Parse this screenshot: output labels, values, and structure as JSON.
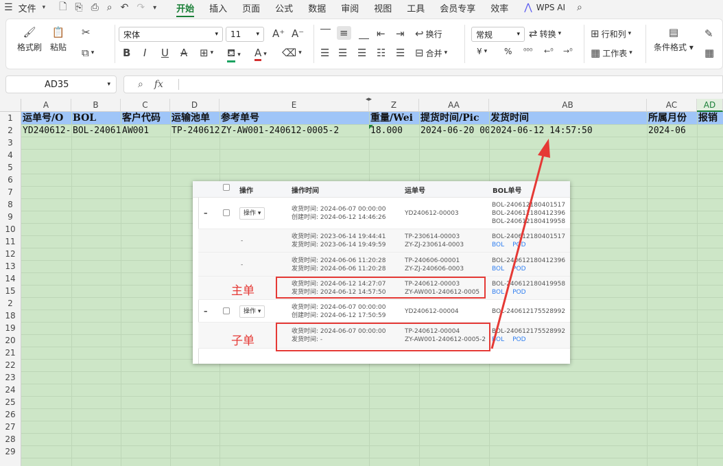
{
  "menubar": {
    "file": "文件",
    "tabs": [
      "开始",
      "插入",
      "页面",
      "公式",
      "数据",
      "审阅",
      "视图",
      "工具",
      "会员专享",
      "效率"
    ],
    "wps_ai": "WPS AI"
  },
  "ribbon": {
    "format_painter": "格式刷",
    "paste": "粘贴",
    "font_name": "宋体",
    "font_size": "11",
    "wrap": "换行",
    "merge": "合并",
    "number_format": "常规",
    "convert": "转换",
    "row_col": "行和列",
    "worksheet": "工作表",
    "cond_format": "条件格式",
    "currency_symbol": "¥",
    "percent": "%"
  },
  "formula_bar": {
    "name_box": "AD35",
    "fx": "fx",
    "value": ""
  },
  "columns": [
    "A",
    "B",
    "C",
    "D",
    "E",
    "Z",
    "AA",
    "AB",
    "AC",
    "AD"
  ],
  "rows": [
    "1",
    "2",
    "3",
    "4",
    "5",
    "6",
    "7",
    "8",
    "9",
    "10",
    "11",
    "12",
    "13",
    "14",
    "15",
    "2",
    "18",
    "19",
    "20",
    "21",
    "22",
    "23",
    "24",
    "25",
    "26",
    "27",
    "28",
    "29"
  ],
  "row1": [
    "运单号/O",
    "BOL",
    "客户代码",
    "运输池单",
    "参考单号",
    "重量/Wei",
    "提货时间/Pic",
    "发货时间",
    "所属月份",
    "报销"
  ],
  "row2": [
    "YD240612-",
    "BOL-24061",
    "AW001",
    "TP-240612",
    "ZY-AW001-240612-0005-2",
    "18.000",
    "2024-06-20 00",
    "2024-06-12 14:57:50",
    "2024-06",
    ""
  ],
  "pasted_image": {
    "headers": {
      "op": "操作",
      "op_time": "操作时间",
      "waybill": "运单号",
      "bol": "BOL单号"
    },
    "op_button": "操作",
    "rows": [
      {
        "expand": "–",
        "op": "btn",
        "t1": "收货时间:  2024-06-07 00:00:00",
        "t2": "创建时间:  2024-06-12 14:46:26",
        "w1": "YD240612-00003",
        "w2": "",
        "b1": "BOL-240612180401517",
        "b2": "BOL-240612180412396",
        "b3": "BOL-240612180419958",
        "links": false
      },
      {
        "expand": "",
        "op": "-",
        "t1": "收货时间:  2023-06-14 19:44:41",
        "t2": "发货时间:  2023-06-14 19:49:59",
        "w1": "TP-230614-00003",
        "w2": "ZY-ZJ-230614-0003",
        "b1": "BOL-240612180401517",
        "b2": "",
        "b3": "",
        "links": true
      },
      {
        "expand": "",
        "op": "-",
        "t1": "收货时间:  2024-06-06 11:20:28",
        "t2": "发货时间:  2024-06-06 11:20:28",
        "w1": "TP-240606-00001",
        "w2": "ZY-ZJ-240606-0003",
        "b1": "BOL-240612180412396",
        "b2": "",
        "b3": "",
        "links": true
      },
      {
        "expand": "",
        "op": "",
        "t1": "收货时间:  2024-06-12 14:27:07",
        "t2": "发货时间:  2024-06-12 14:57:50",
        "w1": "TP-240612-00003",
        "w2": "ZY-AW001-240612-0005",
        "b1": "BOL-240612180419958",
        "b2": "",
        "b3": "",
        "links": true
      },
      {
        "expand": "–",
        "op": "btn",
        "t1": "收货时间:  2024-06-07 00:00:00",
        "t2": "创建时间:  2024-06-12 17:50:59",
        "w1": "YD240612-00004",
        "w2": "",
        "b1": "BOL-240612175528992",
        "b2": "",
        "b3": "",
        "links": false
      },
      {
        "expand": "",
        "op": "",
        "t1": "收货时间:  2024-06-07 00:00:00",
        "t2": "发货时间:  -",
        "w1": "TP-240612-00004",
        "w2": "ZY-AW001-240612-0005-2",
        "b1": "BOL-240612175528992",
        "b2": "",
        "b3": "",
        "links": true
      }
    ],
    "link_bol": "BOL",
    "link_pod": "POD",
    "label_main": "主单",
    "label_sub": "子单"
  },
  "colors": {
    "accent": "#1a7f37",
    "header_fill": "#9fc5f8",
    "sheet_bg": "#cde6c7",
    "annotation": "#e53935"
  }
}
